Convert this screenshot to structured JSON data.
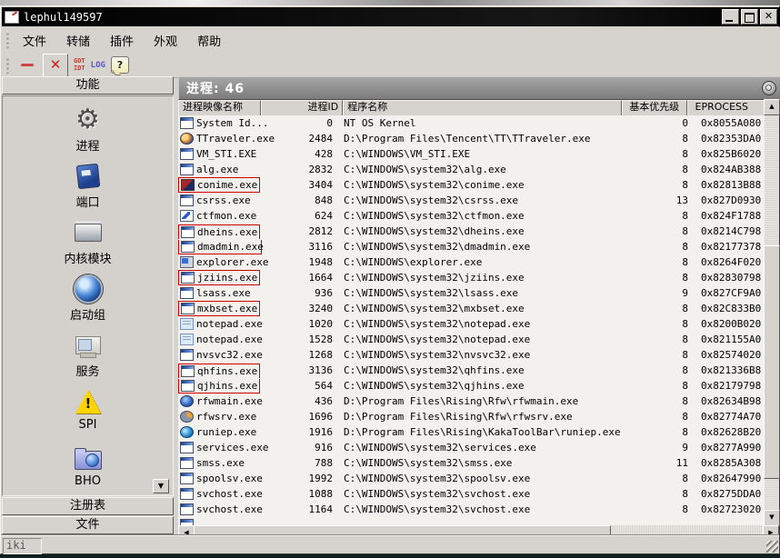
{
  "window": {
    "title": "lephul149597"
  },
  "menu": {
    "items": [
      {
        "name": "file",
        "label": "文件"
      },
      {
        "name": "dump",
        "label": "转储"
      },
      {
        "name": "plugin",
        "label": "插件"
      },
      {
        "name": "appearance",
        "label": "外观"
      },
      {
        "name": "help",
        "label": "帮助"
      }
    ]
  },
  "toolbar": {
    "gdt": "GDT",
    "idt": "IDT",
    "log": "LOG",
    "help": "?"
  },
  "sidebar": {
    "header": "功能",
    "items": [
      {
        "name": "process",
        "label": "进程",
        "icon": "gear-icon"
      },
      {
        "name": "port",
        "label": "端口",
        "icon": "port-icon"
      },
      {
        "name": "kernel-module",
        "label": "内核模块",
        "icon": "module-icon"
      },
      {
        "name": "startup-group",
        "label": "启动组",
        "icon": "globe-icon"
      },
      {
        "name": "services",
        "label": "服务",
        "icon": "monitor-icon"
      },
      {
        "name": "spi",
        "label": "SPI",
        "icon": "warning-icon"
      },
      {
        "name": "bho",
        "label": "BHO",
        "icon": "folder-icon"
      }
    ],
    "registry": "注册表",
    "files": "文件"
  },
  "main": {
    "header_title": "进程: 46",
    "columns": [
      "进程映像名称",
      "进程ID",
      "程序名称",
      "基本优先级",
      "EPROCESS"
    ],
    "rows": [
      {
        "icon": "window-icon",
        "name": "System Id...",
        "pid": "0",
        "path": "NT OS Kernel",
        "priority": "0",
        "eprocess": "0x8055A080",
        "mark": null
      },
      {
        "icon": "tt-browser-icon",
        "name": "TTraveler.exe",
        "pid": "2484",
        "path": "D:\\Program Files\\Tencent\\TT\\TTraveler.exe",
        "priority": "8",
        "eprocess": "0x82353DA0",
        "mark": null
      },
      {
        "icon": "window-icon",
        "name": "VM_STI.EXE",
        "pid": "428",
        "path": "C:\\WINDOWS\\VM_STI.EXE",
        "priority": "8",
        "eprocess": "0x825B6020",
        "mark": null
      },
      {
        "icon": "window-icon",
        "name": "alg.exe",
        "pid": "2832",
        "path": "C:\\WINDOWS\\system32\\alg.exe",
        "priority": "8",
        "eprocess": "0x824AB388",
        "mark": null
      },
      {
        "icon": "conime-icon",
        "name": "conime.exe",
        "pid": "3404",
        "path": "C:\\WINDOWS\\system32\\conime.exe",
        "priority": "8",
        "eprocess": "0x82813B88",
        "mark": "single"
      },
      {
        "icon": "window-icon",
        "name": "csrss.exe",
        "pid": "848",
        "path": "C:\\WINDOWS\\system32\\csrss.exe",
        "priority": "13",
        "eprocess": "0x827D0930",
        "mark": null
      },
      {
        "icon": "ctfmon-pen-icon",
        "name": "ctfmon.exe",
        "pid": "624",
        "path": "C:\\WINDOWS\\system32\\ctfmon.exe",
        "priority": "8",
        "eprocess": "0x824F1788",
        "mark": null
      },
      {
        "icon": "window-icon",
        "name": "dheins.exe",
        "pid": "2812",
        "path": "C:\\WINDOWS\\system32\\dheins.exe",
        "priority": "8",
        "eprocess": "0x8214C798",
        "mark": "top"
      },
      {
        "icon": "window-icon",
        "name": "dmadmin.exe",
        "pid": "3116",
        "path": "C:\\WINDOWS\\system32\\dmadmin.exe",
        "priority": "8",
        "eprocess": "0x82177378",
        "mark": "bottom"
      },
      {
        "icon": "explorer-icon",
        "name": "explorer.exe",
        "pid": "1948",
        "path": "C:\\WINDOWS\\explorer.exe",
        "priority": "8",
        "eprocess": "0x8264F020",
        "mark": null
      },
      {
        "icon": "window-icon",
        "name": "jziins.exe",
        "pid": "1664",
        "path": "C:\\WINDOWS\\system32\\jziins.exe",
        "priority": "8",
        "eprocess": "0x82830798",
        "mark": "single"
      },
      {
        "icon": "window-icon",
        "name": "lsass.exe",
        "pid": "936",
        "path": "C:\\WINDOWS\\system32\\lsass.exe",
        "priority": "9",
        "eprocess": "0x827CF9A0",
        "mark": null
      },
      {
        "icon": "window-icon",
        "name": "mxbset.exe",
        "pid": "3240",
        "path": "C:\\WINDOWS\\system32\\mxbset.exe",
        "priority": "8",
        "eprocess": "0x82C833B0",
        "mark": "single"
      },
      {
        "icon": "notepad-icon",
        "name": "notepad.exe",
        "pid": "1020",
        "path": "C:\\WINDOWS\\system32\\notepad.exe",
        "priority": "8",
        "eprocess": "0x8200B020",
        "mark": null
      },
      {
        "icon": "notepad-icon",
        "name": "notepad.exe",
        "pid": "1528",
        "path": "C:\\WINDOWS\\system32\\notepad.exe",
        "priority": "8",
        "eprocess": "0x821155A0",
        "mark": null
      },
      {
        "icon": "window-icon",
        "name": "nvsvc32.exe",
        "pid": "1268",
        "path": "C:\\WINDOWS\\system32\\nvsvc32.exe",
        "priority": "8",
        "eprocess": "0x82574020",
        "mark": null
      },
      {
        "icon": "window-icon",
        "name": "qhfins.exe",
        "pid": "3136",
        "path": "C:\\WINDOWS\\system32\\qhfins.exe",
        "priority": "8",
        "eprocess": "0x821336B8",
        "mark": "top"
      },
      {
        "icon": "window-icon",
        "name": "qjhins.exe",
        "pid": "564",
        "path": "C:\\WINDOWS\\system32\\qjhins.exe",
        "priority": "8",
        "eprocess": "0x82179798",
        "mark": "bottom"
      },
      {
        "icon": "rising-globe-icon",
        "name": "rfwmain.exe",
        "pid": "436",
        "path": "D:\\Program Files\\Rising\\Rfw\\rfwmain.exe",
        "priority": "8",
        "eprocess": "0x82634B98",
        "mark": null
      },
      {
        "icon": "rising-gear-icon",
        "name": "rfwsrv.exe",
        "pid": "1696",
        "path": "D:\\Program Files\\Rising\\Rfw\\rfwsrv.exe",
        "priority": "8",
        "eprocess": "0x82774A70",
        "mark": null
      },
      {
        "icon": "ie-icon",
        "name": "runiep.exe",
        "pid": "1916",
        "path": "D:\\Program Files\\Rising\\KakaToolBar\\runiep.exe",
        "priority": "8",
        "eprocess": "0x82628B20",
        "mark": null
      },
      {
        "icon": "window-icon",
        "name": "services.exe",
        "pid": "916",
        "path": "C:\\WINDOWS\\system32\\services.exe",
        "priority": "9",
        "eprocess": "0x8277A990",
        "mark": null
      },
      {
        "icon": "window-icon",
        "name": "smss.exe",
        "pid": "788",
        "path": "C:\\WINDOWS\\system32\\smss.exe",
        "priority": "11",
        "eprocess": "0x8285A308",
        "mark": null
      },
      {
        "icon": "window-icon",
        "name": "spoolsv.exe",
        "pid": "1992",
        "path": "C:\\WINDOWS\\system32\\spoolsv.exe",
        "priority": "8",
        "eprocess": "0x82647990",
        "mark": null
      },
      {
        "icon": "window-icon",
        "name": "svchost.exe",
        "pid": "1088",
        "path": "C:\\WINDOWS\\system32\\svchost.exe",
        "priority": "8",
        "eprocess": "0x8275DDA0",
        "mark": null
      },
      {
        "icon": "window-icon",
        "name": "svchost.exe",
        "pid": "1164",
        "path": "C:\\WINDOWS\\system32\\svchost.exe",
        "priority": "8",
        "eprocess": "0x82723020",
        "mark": null
      },
      {
        "icon": "window-icon",
        "name": "",
        "pid": "",
        "path": "",
        "priority": "",
        "eprocess": "",
        "mark": null
      }
    ]
  },
  "statusbar": {
    "left": "iki"
  },
  "colors": {
    "mark_red": "#cc0000",
    "titlebar": "#0a0a0a",
    "button_face": "#d6d3ce"
  }
}
